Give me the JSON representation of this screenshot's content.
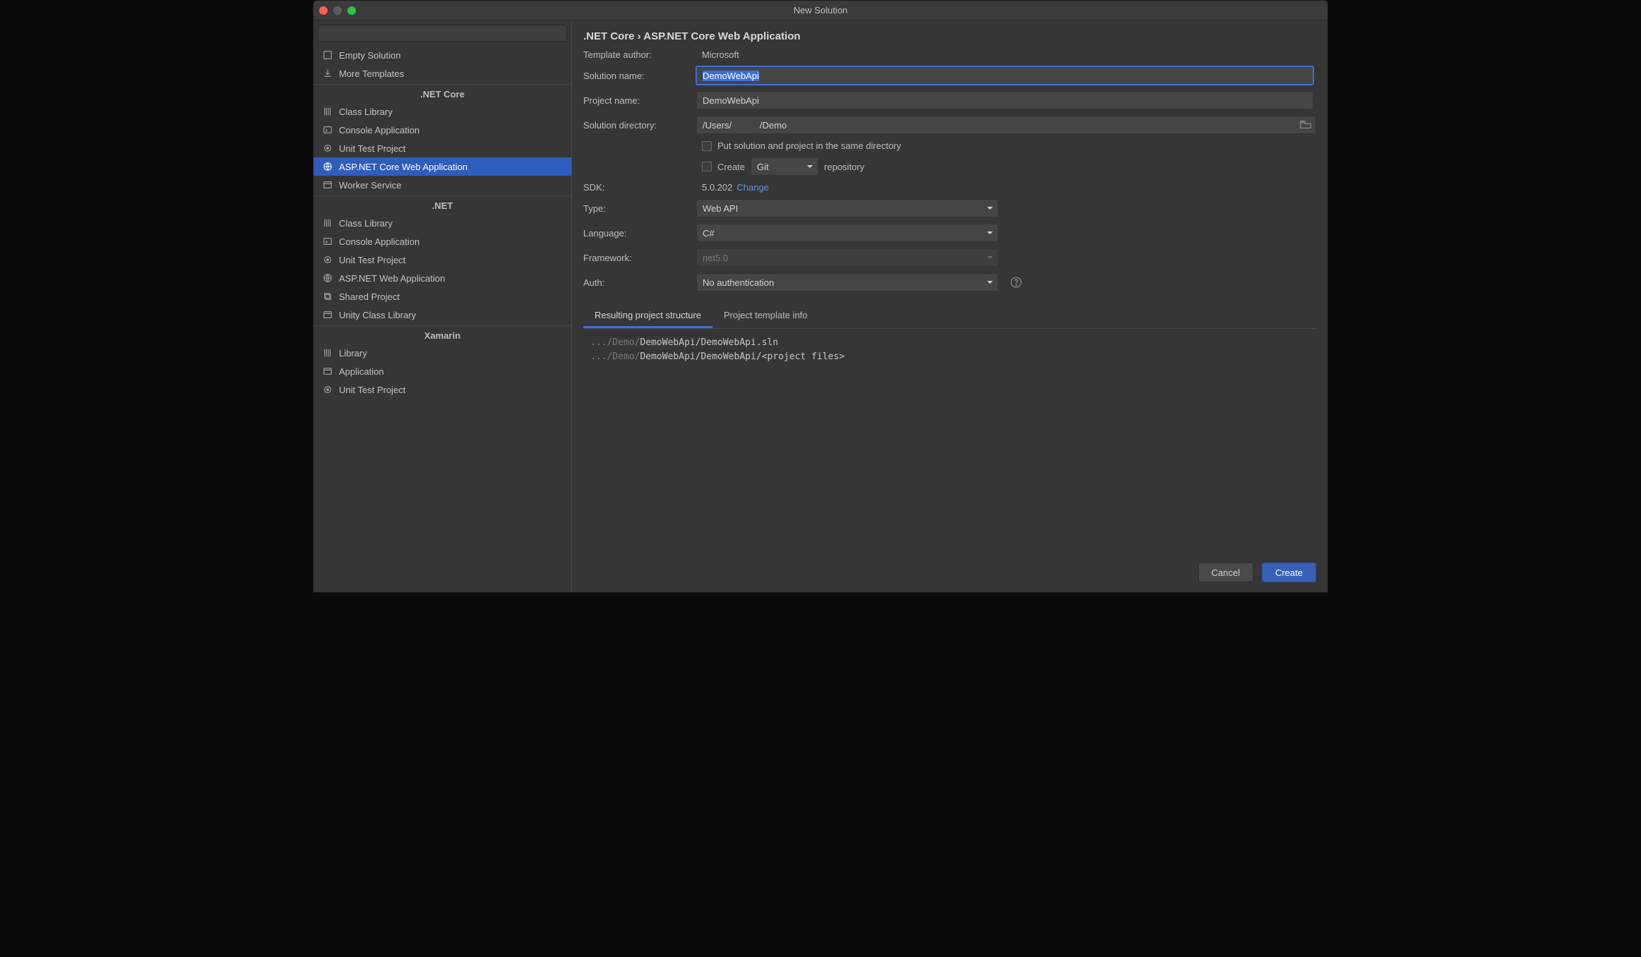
{
  "window": {
    "title": "New Solution"
  },
  "sidebar": {
    "search_placeholder": "",
    "top_items": [
      {
        "icon": "square-icon",
        "label": "Empty Solution"
      },
      {
        "icon": "download-icon",
        "label": "More Templates"
      }
    ],
    "groups": [
      {
        "title": ".NET Core",
        "items": [
          {
            "icon": "library-icon",
            "label": "Class Library"
          },
          {
            "icon": "console-icon",
            "label": "Console Application"
          },
          {
            "icon": "test-icon",
            "label": "Unit Test Project"
          },
          {
            "icon": "globe-icon",
            "label": "ASP.NET Core Web Application",
            "selected": true
          },
          {
            "icon": "window-icon",
            "label": "Worker Service"
          }
        ]
      },
      {
        "title": ".NET",
        "items": [
          {
            "icon": "library-icon",
            "label": "Class Library"
          },
          {
            "icon": "console-icon",
            "label": "Console Application"
          },
          {
            "icon": "test-icon",
            "label": "Unit Test Project"
          },
          {
            "icon": "globe-icon",
            "label": "ASP.NET Web Application"
          },
          {
            "icon": "stack-icon",
            "label": "Shared Project"
          },
          {
            "icon": "window-icon",
            "label": "Unity Class Library"
          }
        ]
      },
      {
        "title": "Xamarin",
        "items": [
          {
            "icon": "library-icon",
            "label": "Library"
          },
          {
            "icon": "window-icon",
            "label": "Application"
          },
          {
            "icon": "test-icon",
            "label": "Unit Test Project"
          }
        ]
      }
    ]
  },
  "breadcrumb": {
    "root": ".NET Core",
    "sep": " › ",
    "leaf": "ASP.NET Core Web Application"
  },
  "form": {
    "template_author_label": "Template author:",
    "template_author": "Microsoft",
    "solution_name_label": "Solution name:",
    "solution_name": "DemoWebApi",
    "project_name_label": "Project name:",
    "project_name": "DemoWebApi",
    "solution_dir_label": "Solution directory:",
    "solution_dir": "/Users/           /Demo",
    "same_dir_label": "Put solution and project in the same directory",
    "create_label": "Create",
    "vcs_value": "Git",
    "repository_label": "repository",
    "sdk_label": "SDK:",
    "sdk_value": "5.0.202",
    "sdk_change": "Change",
    "type_label": "Type:",
    "type_value": "Web API",
    "language_label": "Language:",
    "language_value": "C#",
    "framework_label": "Framework:",
    "framework_value": "net5.0",
    "auth_label": "Auth:",
    "auth_value": "No authentication"
  },
  "tabs": {
    "structure": "Resulting project structure",
    "info": "Project template info"
  },
  "structure": [
    {
      "dim": ".../Demo/",
      "norm": "DemoWebApi/DemoWebApi.sln"
    },
    {
      "dim": ".../Demo/",
      "norm": "DemoWebApi/DemoWebApi/<project files>"
    }
  ],
  "footer": {
    "cancel": "Cancel",
    "create": "Create"
  }
}
